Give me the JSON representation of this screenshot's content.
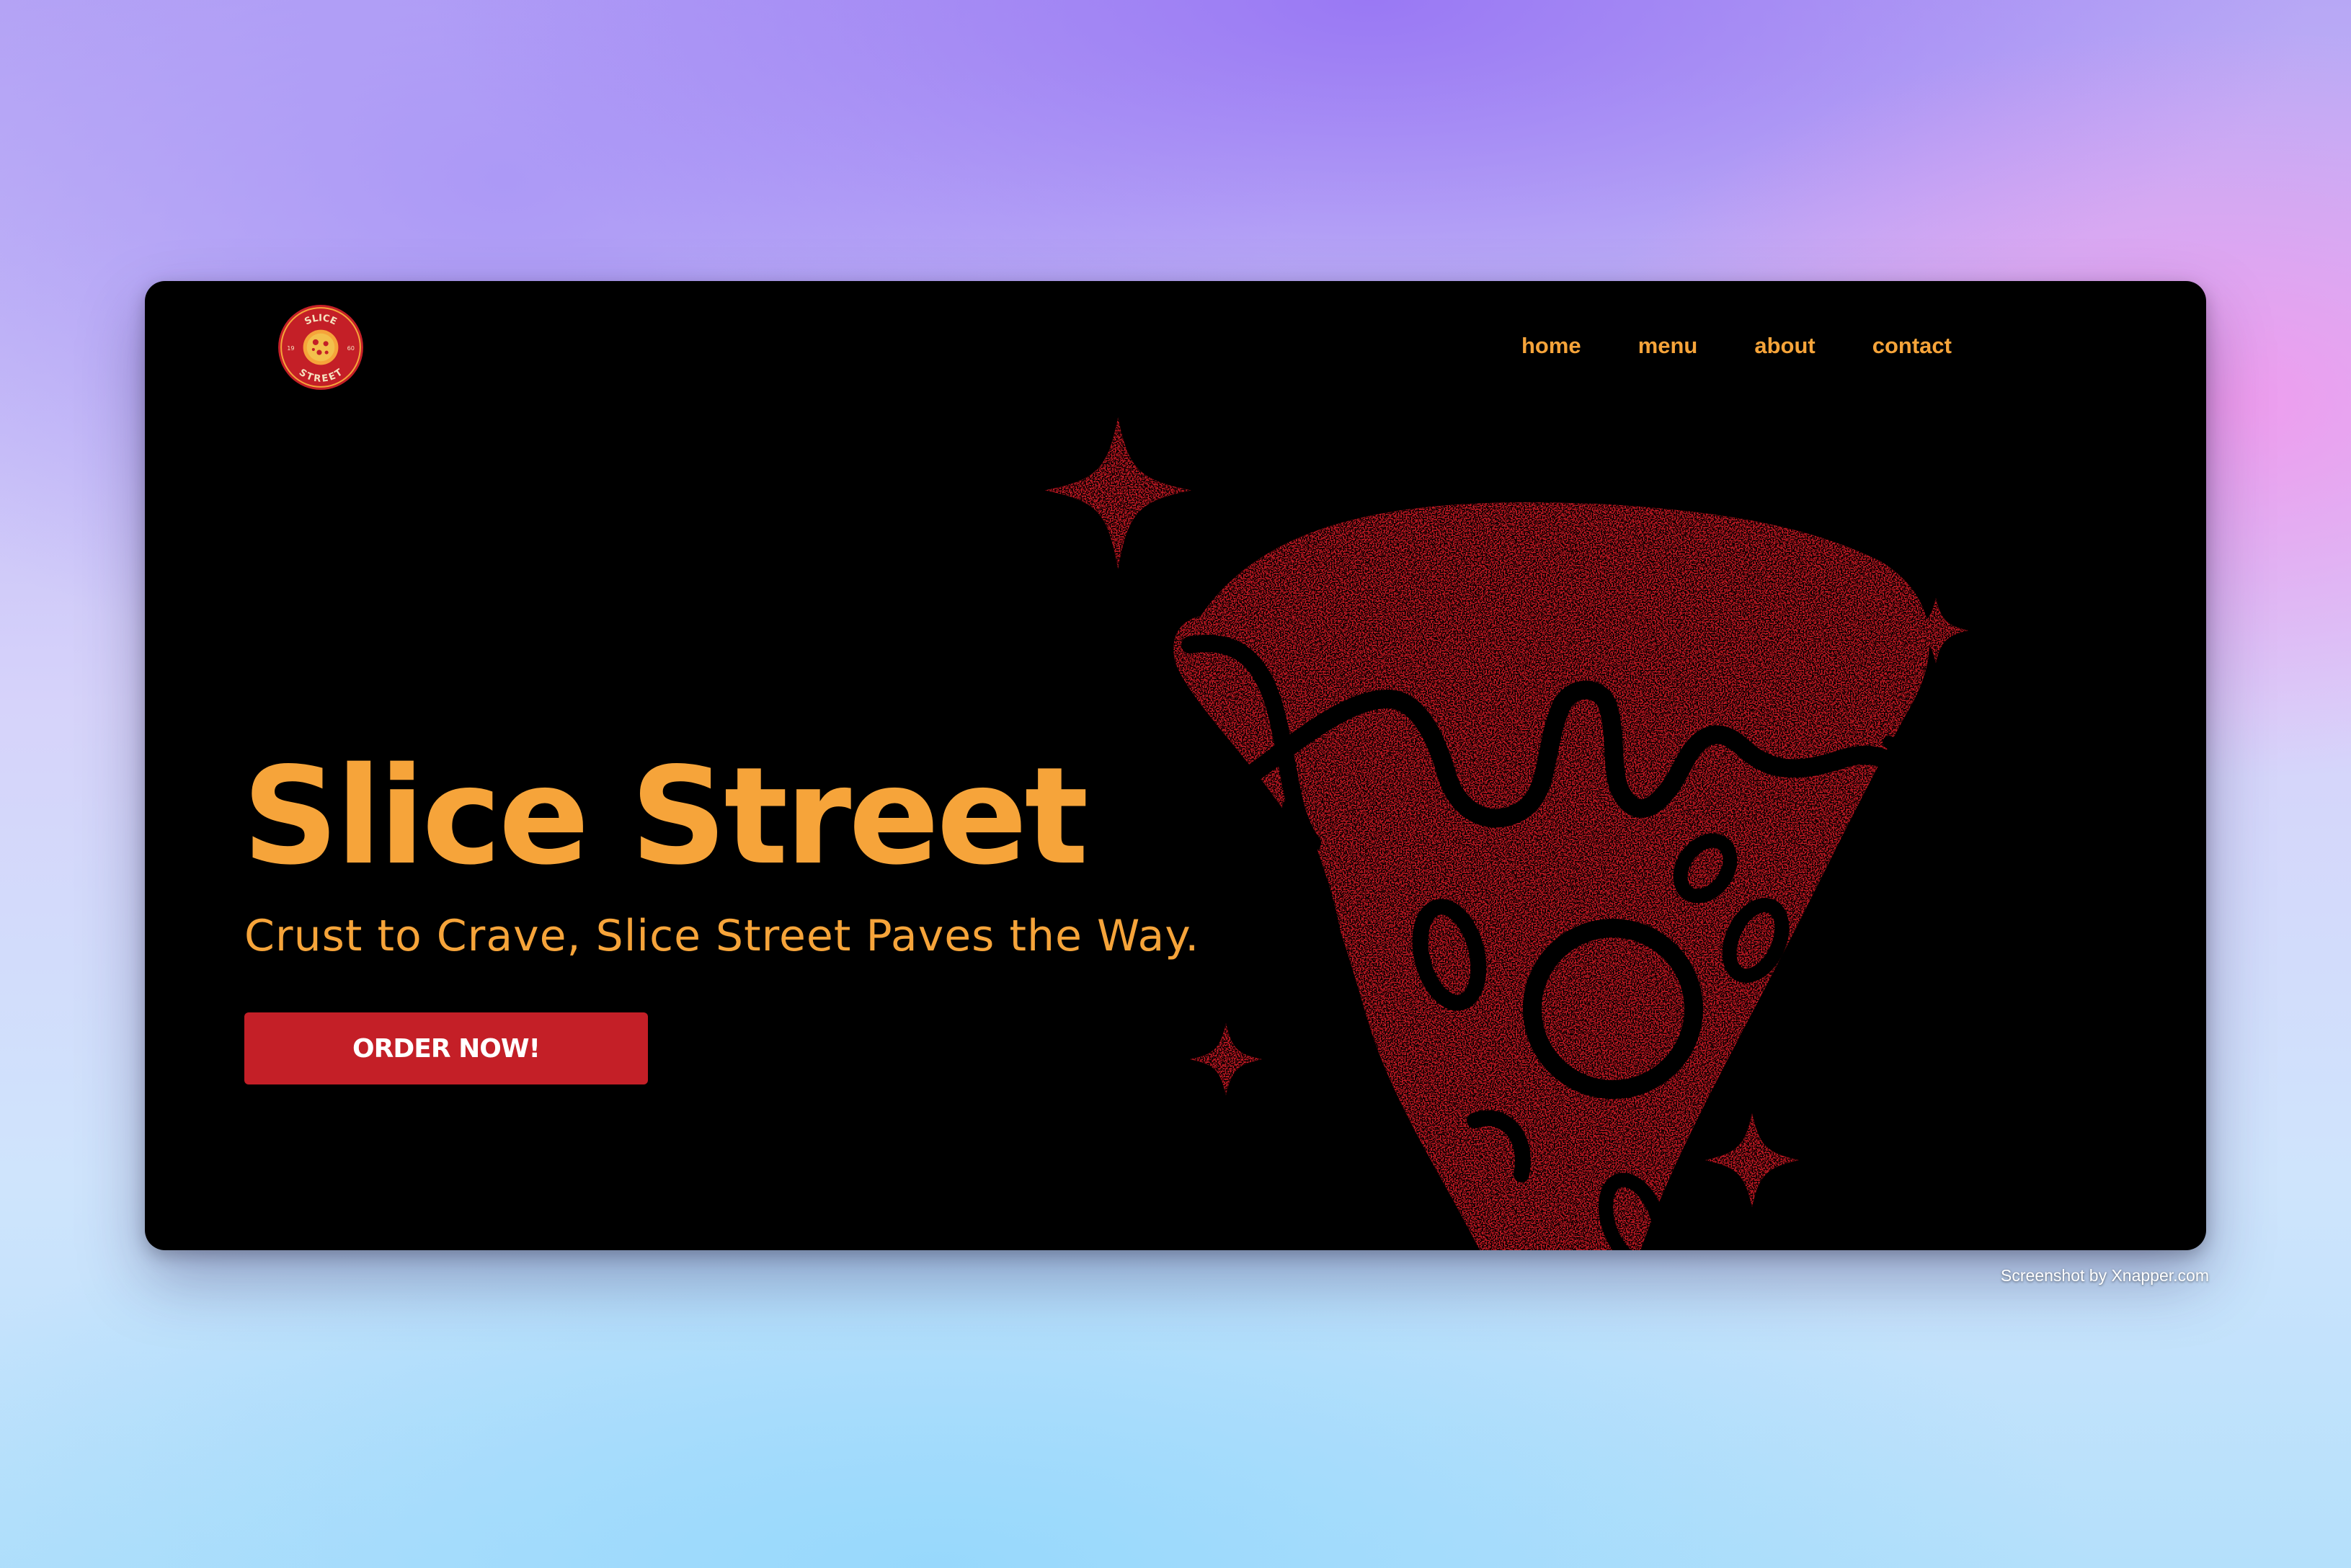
{
  "brand": {
    "name": "Slice Street",
    "logo_top_text": "SLICE",
    "logo_bottom_text": "STREET",
    "logo_left_text": "19",
    "logo_right_text": "60"
  },
  "nav": {
    "items": [
      {
        "label": "home"
      },
      {
        "label": "menu"
      },
      {
        "label": "about"
      },
      {
        "label": "contact"
      }
    ]
  },
  "hero": {
    "title": "Slice Street",
    "tagline": "Crust to Crave, Slice Street Paves the Way.",
    "cta_label": "ORDER NOW!"
  },
  "illustration": {
    "icon": "pizza-slice-icon",
    "sparkle_icon": "sparkle-icon"
  },
  "footer": {
    "credit": "Screenshot by Xnapper.com"
  },
  "colors": {
    "accent": "#f6a43a",
    "brand_red": "#c41f27",
    "background": "#000000"
  }
}
